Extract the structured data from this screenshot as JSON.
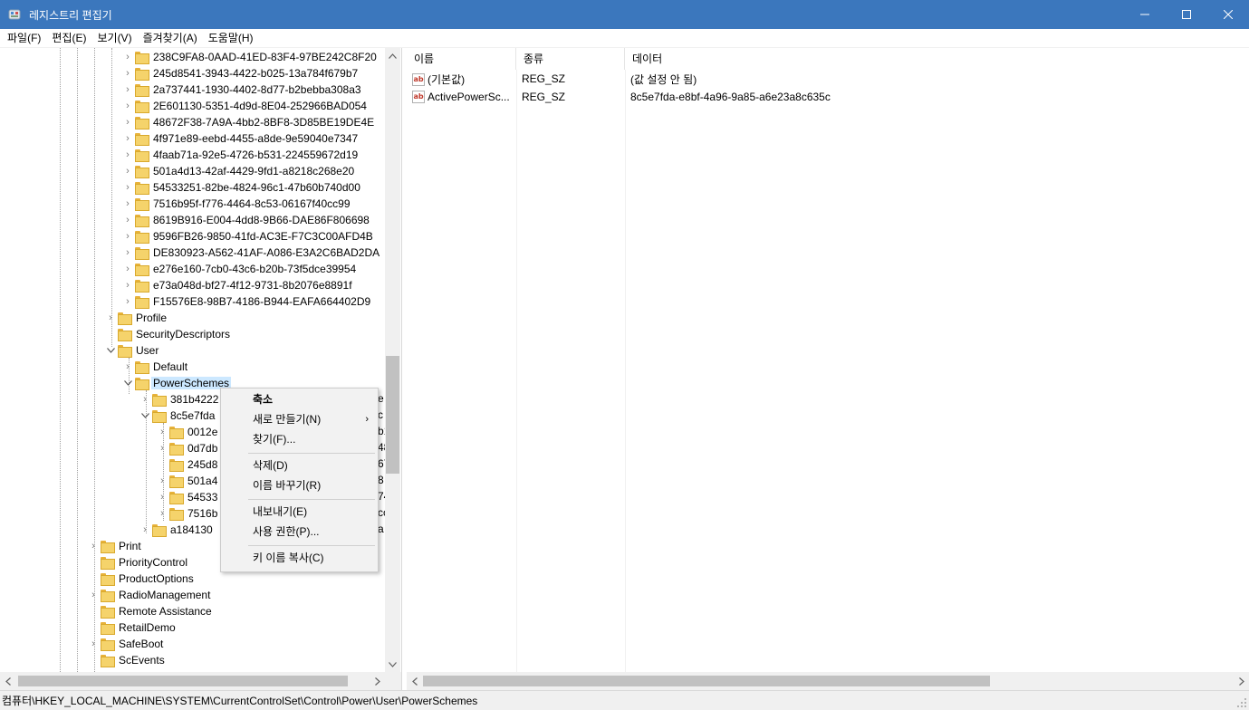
{
  "window": {
    "title": "레지스트리 편집기",
    "minimize": "—",
    "maximize": "☐",
    "close": "✕"
  },
  "menu": [
    {
      "label": "파일(F)"
    },
    {
      "label": "편집(E)"
    },
    {
      "label": "보기(V)"
    },
    {
      "label": "즐겨찾기(A)"
    },
    {
      "label": "도움말(H)"
    }
  ],
  "tree": {
    "guid_keys": [
      "238C9FA8-0AAD-41ED-83F4-97BE242C8F20",
      "245d8541-3943-4422-b025-13a784f679b7",
      "2a737441-1930-4402-8d77-b2bebba308a3",
      "2E601130-5351-4d9d-8E04-252966BAD054",
      "48672F38-7A9A-4bb2-8BF8-3D85BE19DE4E",
      "4f971e89-eebd-4455-a8de-9e59040e7347",
      "4faab71a-92e5-4726-b531-224559672d19",
      "501a4d13-42af-4429-9fd1-a8218c268e20",
      "54533251-82be-4824-96c1-47b60b740d00",
      "7516b95f-f776-4464-8c53-06167f40cc99",
      "8619B916-E004-4dd8-9B66-DAE86F806698",
      "9596FB26-9850-41fd-AC3E-F7C3C00AFD4B",
      "DE830923-A562-41AF-A086-E3A2C6BAD2DA",
      "e276e160-7cb0-43c6-b20b-73f5dce39954",
      "e73a048d-bf27-4f12-9731-8b2076e8891f",
      "F15576E8-98B7-4186-B944-EAFA664402D9"
    ],
    "profile": "Profile",
    "security_descriptors": "SecurityDescriptors",
    "user": "User",
    "default": "Default",
    "power_schemes": "PowerSchemes",
    "scheme_381": "381b4222",
    "scheme_381_tail": "e",
    "scheme_8c5": "8c5e7fda",
    "scheme_8c5_tail": "c",
    "sub_0012": "0012e",
    "sub_0012_tail": "b1",
    "sub_0d7d": "0d7db",
    "sub_0d7d_tail": "48",
    "sub_245d": "245d8",
    "sub_245d_tail": "67",
    "sub_501a": "501a4",
    "sub_501a_tail": "8",
    "sub_5453": "54533",
    "sub_5453_tail": "74",
    "sub_7516": "7516b",
    "sub_7516_tail": "cc",
    "scheme_a18": "a184130",
    "scheme_a18_tail": "a",
    "print": "Print",
    "priority_control": "PriorityControl",
    "product_options": "ProductOptions",
    "radio_management": "RadioManagement",
    "remote_assistance": "Remote Assistance",
    "retail_demo": "RetailDemo",
    "safe_boot": "SafeBoot",
    "sc_events": "ScEvents"
  },
  "list": {
    "columns": [
      "이름",
      "종류",
      "데이터"
    ],
    "rows": [
      {
        "name": "(기본값)",
        "type": "REG_SZ",
        "data": "(값 설정 안 됨)"
      },
      {
        "name": "ActivePowerSc...",
        "type": "REG_SZ",
        "data": "8c5e7fda-e8bf-4a96-9a85-a6e23a8c635c"
      }
    ],
    "icon_text": "ab"
  },
  "context_menu": {
    "collapse": "축소",
    "new": "새로 만들기(N)",
    "find": "찾기(F)...",
    "delete": "삭제(D)",
    "rename": "이름 바꾸기(R)",
    "export": "내보내기(E)",
    "permissions": "사용 권한(P)...",
    "copy_key_name": "키 이름 복사(C)",
    "submenu_arrow": "›"
  },
  "status": {
    "path": "컴퓨터\\HKEY_LOCAL_MACHINE\\SYSTEM\\CurrentControlSet\\Control\\Power\\User\\PowerSchemes"
  },
  "glyphs": {
    "chev_right": "›",
    "chev_down": "⌄",
    "arrow_up": "▲",
    "arrow_down": "▼",
    "arrow_left": "◀",
    "arrow_right": "▶",
    "grip": "⋰"
  }
}
